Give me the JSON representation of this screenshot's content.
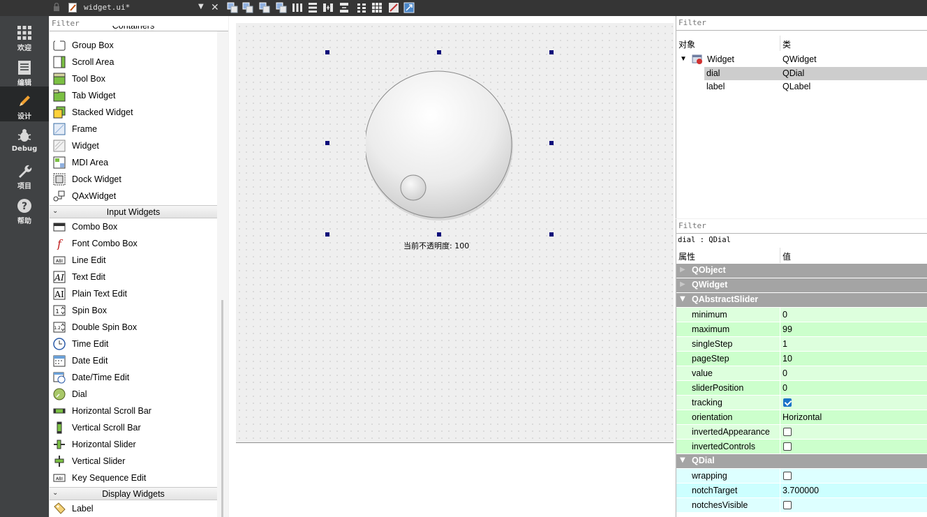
{
  "modebar": [
    {
      "label": "欢迎",
      "icon": "grid-icon"
    },
    {
      "label": "编辑",
      "icon": "edit-doc-icon"
    },
    {
      "label": "设计",
      "icon": "pencil-icon"
    },
    {
      "label": "Debug",
      "icon": "bug-icon"
    },
    {
      "label": "项目",
      "icon": "wrench-icon"
    },
    {
      "label": "帮助",
      "icon": "help-icon"
    }
  ],
  "toolbar": {
    "filename": "widget.ui*"
  },
  "widgetbox": {
    "filter_placeholder": "Filter",
    "containers_partial": "Containers",
    "containers": [
      "Group Box",
      "Scroll Area",
      "Tool Box",
      "Tab Widget",
      "Stacked Widget",
      "Frame",
      "Widget",
      "MDI Area",
      "Dock Widget",
      "QAxWidget"
    ],
    "input_title": "Input Widgets",
    "input": [
      "Combo Box",
      "Font Combo Box",
      "Line Edit",
      "Text Edit",
      "Plain Text Edit",
      "Spin Box",
      "Double Spin Box",
      "Time Edit",
      "Date Edit",
      "Date/Time Edit",
      "Dial",
      "Horizontal Scroll Bar",
      "Vertical Scroll Bar",
      "Horizontal Slider",
      "Vertical Slider",
      "Key Sequence Edit"
    ],
    "display_title": "Display Widgets",
    "display": [
      "Label"
    ]
  },
  "form": {
    "label_text": "当前不透明度: 100",
    "dial_value": 0
  },
  "object_inspector": {
    "filter_placeholder": "Filter",
    "col_object": "对象",
    "col_class": "类",
    "rows": [
      {
        "name": "Widget",
        "cls": "QWidget"
      },
      {
        "name": "dial",
        "cls": "QDial"
      },
      {
        "name": "label",
        "cls": "QLabel"
      }
    ]
  },
  "property_editor": {
    "filter_placeholder": "Filter",
    "object_class": "dial : QDial",
    "col_prop": "属性",
    "col_value": "值",
    "groups_collapsed": [
      "QObject",
      "QWidget"
    ],
    "slider_group": "QAbstractSlider",
    "slider_props": [
      {
        "name": "minimum",
        "value": "0"
      },
      {
        "name": "maximum",
        "value": "99"
      },
      {
        "name": "singleStep",
        "value": "1"
      },
      {
        "name": "pageStep",
        "value": "10"
      },
      {
        "name": "value",
        "value": "0"
      },
      {
        "name": "sliderPosition",
        "value": "0"
      },
      {
        "name": "tracking",
        "checked": true
      },
      {
        "name": "orientation",
        "value": "Horizontal"
      },
      {
        "name": "invertedAppearance",
        "checked": false
      },
      {
        "name": "invertedControls",
        "checked": false
      }
    ],
    "dial_group": "QDial",
    "dial_props": [
      {
        "name": "wrapping",
        "checked": false
      },
      {
        "name": "notchTarget",
        "value": "3.700000"
      },
      {
        "name": "notchesVisible",
        "checked": false
      }
    ]
  },
  "colors": {
    "mode_bar": "#404244",
    "slider_row": "#ccffcc",
    "dial_row": "#ccffff",
    "group_header": "#a4a4a4",
    "selection_handle": "#0b0b7a"
  }
}
